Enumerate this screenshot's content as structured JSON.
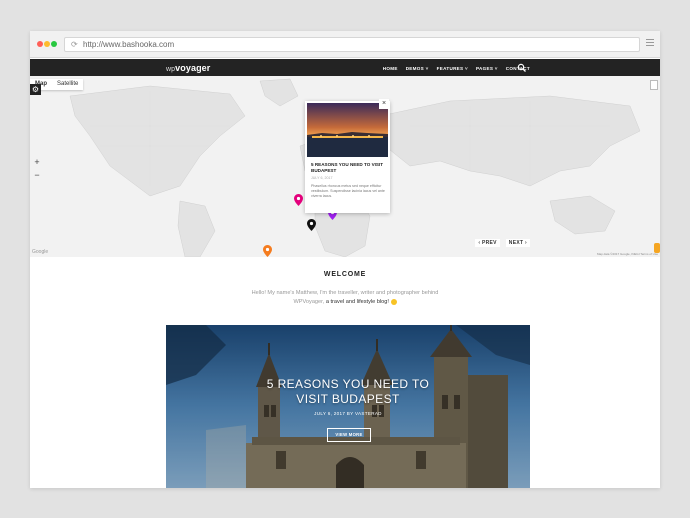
{
  "browser": {
    "url": "http://www.bashooka.com"
  },
  "nav": {
    "logo_prefix": "wp",
    "logo_main": "voyager",
    "items": [
      {
        "label": "HOME"
      },
      {
        "label": "DEMOS ˅"
      },
      {
        "label": "FEATURES ˅"
      },
      {
        "label": "PAGES ˅"
      },
      {
        "label": "CONTACT"
      }
    ],
    "search_icon": "search-icon"
  },
  "map": {
    "type_map": "Map",
    "type_satellite": "Satellite",
    "zoom_in": "+",
    "zoom_out": "−",
    "google_label": "Google",
    "footer": "Map data ©2017 Google, INEGI  Terms of Use",
    "prev": "‹ PREV",
    "next": "NEXT ›",
    "popup": {
      "close": "×",
      "title": "5 REASONS YOU NEED TO VISIT BUDAPEST",
      "date": "JULY 6, 2017",
      "excerpt": "Phasellus rhoncus metus sed neque efficitur vestibulum. Suspendisse lacinia lacus vel ante viverra lacus."
    },
    "marker_colors": {
      "pink": "#e4007c",
      "purple": "#a020f0",
      "black": "#111111",
      "orange": "#f57c1f"
    }
  },
  "welcome": {
    "title": "WELCOME",
    "line1": "Hello! My name's Matthew, I'm the traveller, writer and photographer behind",
    "line2_pre": "WPVoyager, ",
    "line2_bold": "a travel and lifestyle blog!"
  },
  "feature": {
    "title_line1": "5 REASONS YOU NEED TO",
    "title_line2": "VISIT BUDAPEST",
    "meta": "JULY 6, 2017 BY VASTERAD",
    "button": "VIEW MORE"
  }
}
